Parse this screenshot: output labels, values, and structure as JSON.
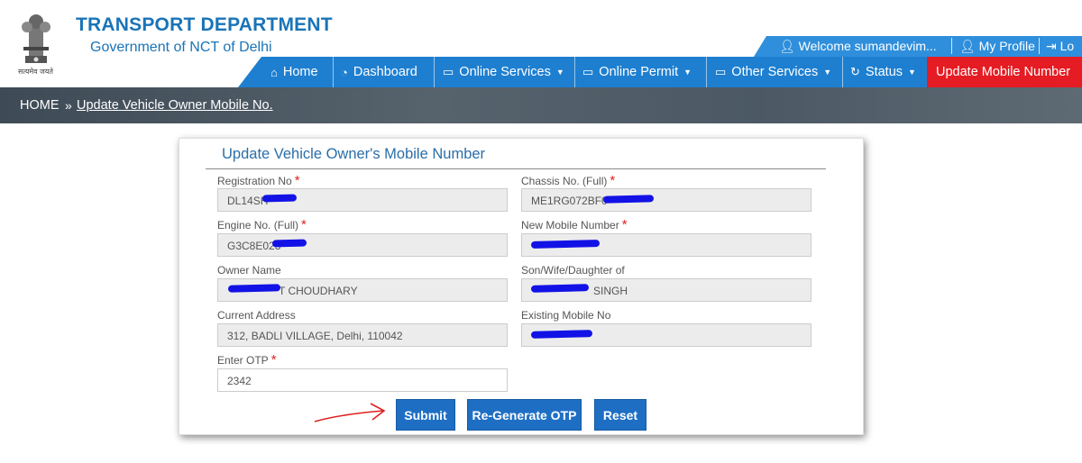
{
  "header": {
    "title": "TRANSPORT DEPARTMENT",
    "subtitle": "Government of NCT of Delhi",
    "emblem_caption": "सत्यमेव जयते"
  },
  "userbar": {
    "welcome": "Welcome  sumandevim...",
    "my_profile": "My Profile",
    "logout": "Lo"
  },
  "nav": [
    {
      "label": "Home",
      "icon": "home-icon"
    },
    {
      "label": "Dashboard",
      "icon": "dashboard-icon"
    },
    {
      "label": "Online Services",
      "icon": "monitor-icon",
      "dropdown": true
    },
    {
      "label": "Online Permit",
      "icon": "monitor-icon",
      "dropdown": true
    },
    {
      "label": "Other Services",
      "icon": "monitor-icon",
      "dropdown": true
    },
    {
      "label": "Status",
      "icon": "refresh-icon",
      "dropdown": true
    },
    {
      "label": "Update Mobile Number",
      "active": true
    }
  ],
  "breadcrumb": {
    "home": "HOME",
    "separator": "»",
    "current": "Update Vehicle Owner Mobile No."
  },
  "form": {
    "title": "Update Vehicle Owner's Mobile Number",
    "fields": {
      "registration_no": {
        "label": "Registration No",
        "value": "DL14SH",
        "required": true
      },
      "chassis_no": {
        "label": "Chassis No. (Full)",
        "value": "ME1RG072BF0",
        "required": true
      },
      "engine_no": {
        "label": "Engine No. (Full)",
        "value": "G3C8E023",
        "required": true
      },
      "new_mobile": {
        "label": "New Mobile Number",
        "value": "",
        "required": true
      },
      "owner_name": {
        "label": "Owner Name",
        "value": "T CHOUDHARY"
      },
      "relation_name": {
        "label": "Son/Wife/Daughter of",
        "value": "SINGH"
      },
      "current_address": {
        "label": "Current Address",
        "value": "312, BADLI VILLAGE, Delhi, 110042"
      },
      "existing_mobile": {
        "label": "Existing Mobile No",
        "value": ""
      },
      "otp": {
        "label": "Enter OTP",
        "value": "2342",
        "required": true
      }
    },
    "buttons": {
      "submit": "Submit",
      "regenerate": "Re-Generate OTP",
      "reset": "Reset"
    }
  },
  "colors": {
    "brand_blue": "#1a74b7",
    "nav_blue": "#1e7fd0",
    "active_red": "#e51c23",
    "button_blue": "#1e6fc4"
  }
}
